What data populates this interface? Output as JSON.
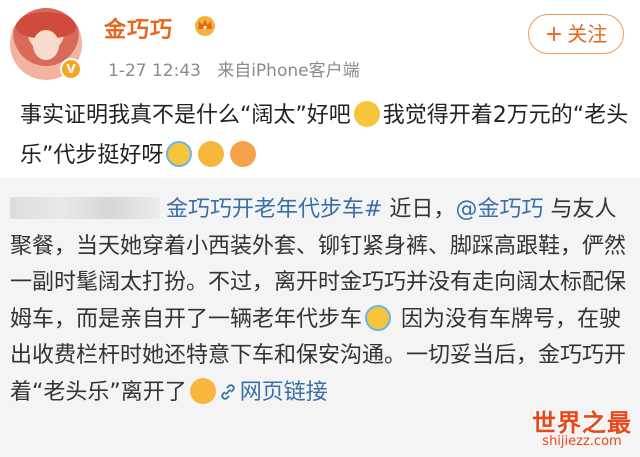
{
  "user": {
    "name": "金巧巧",
    "verified_badge": "V",
    "time": "1-27 12:43",
    "source_prefix": "来自",
    "source": "iPhone客户端"
  },
  "follow_button": {
    "label": "关注"
  },
  "post": {
    "text_before_emoji": "事实证明我真不是什么“阔太”好吧",
    "text_after_emoji": "我觉得开着2万元的“老头乐”代步挺好呀",
    "emojis": [
      "hug-emoji",
      "laugh-cry-emoji",
      "tongue-emoji",
      "drool-emoji"
    ]
  },
  "repost": {
    "hashtag": "金巧巧开老年代步车#",
    "text_1": " 近日，",
    "mention": "@金巧巧",
    "text_2": " 与友人聚餐，当天她穿着小西装外套、铆钉紧身裤、脚踩高跟鞋，俨然一副时髦阔太打扮。不过，离开时金巧巧并没有走向阔太标配保姆车，而是亲自开了一辆老年代步车",
    "text_3": " 因为没有车牌号，在驶出收费栏杆时她还特意下车和保安沟通。一切妥当后，金巧巧开着“老头乐”离开了",
    "web_link": "网页链接"
  },
  "watermark": {
    "main": "世界之最",
    "sub": "shijiezz.com"
  },
  "colors": {
    "accent": "#e8651a",
    "link": "#3a6ea8",
    "repost_bg": "#f4f4f4"
  }
}
